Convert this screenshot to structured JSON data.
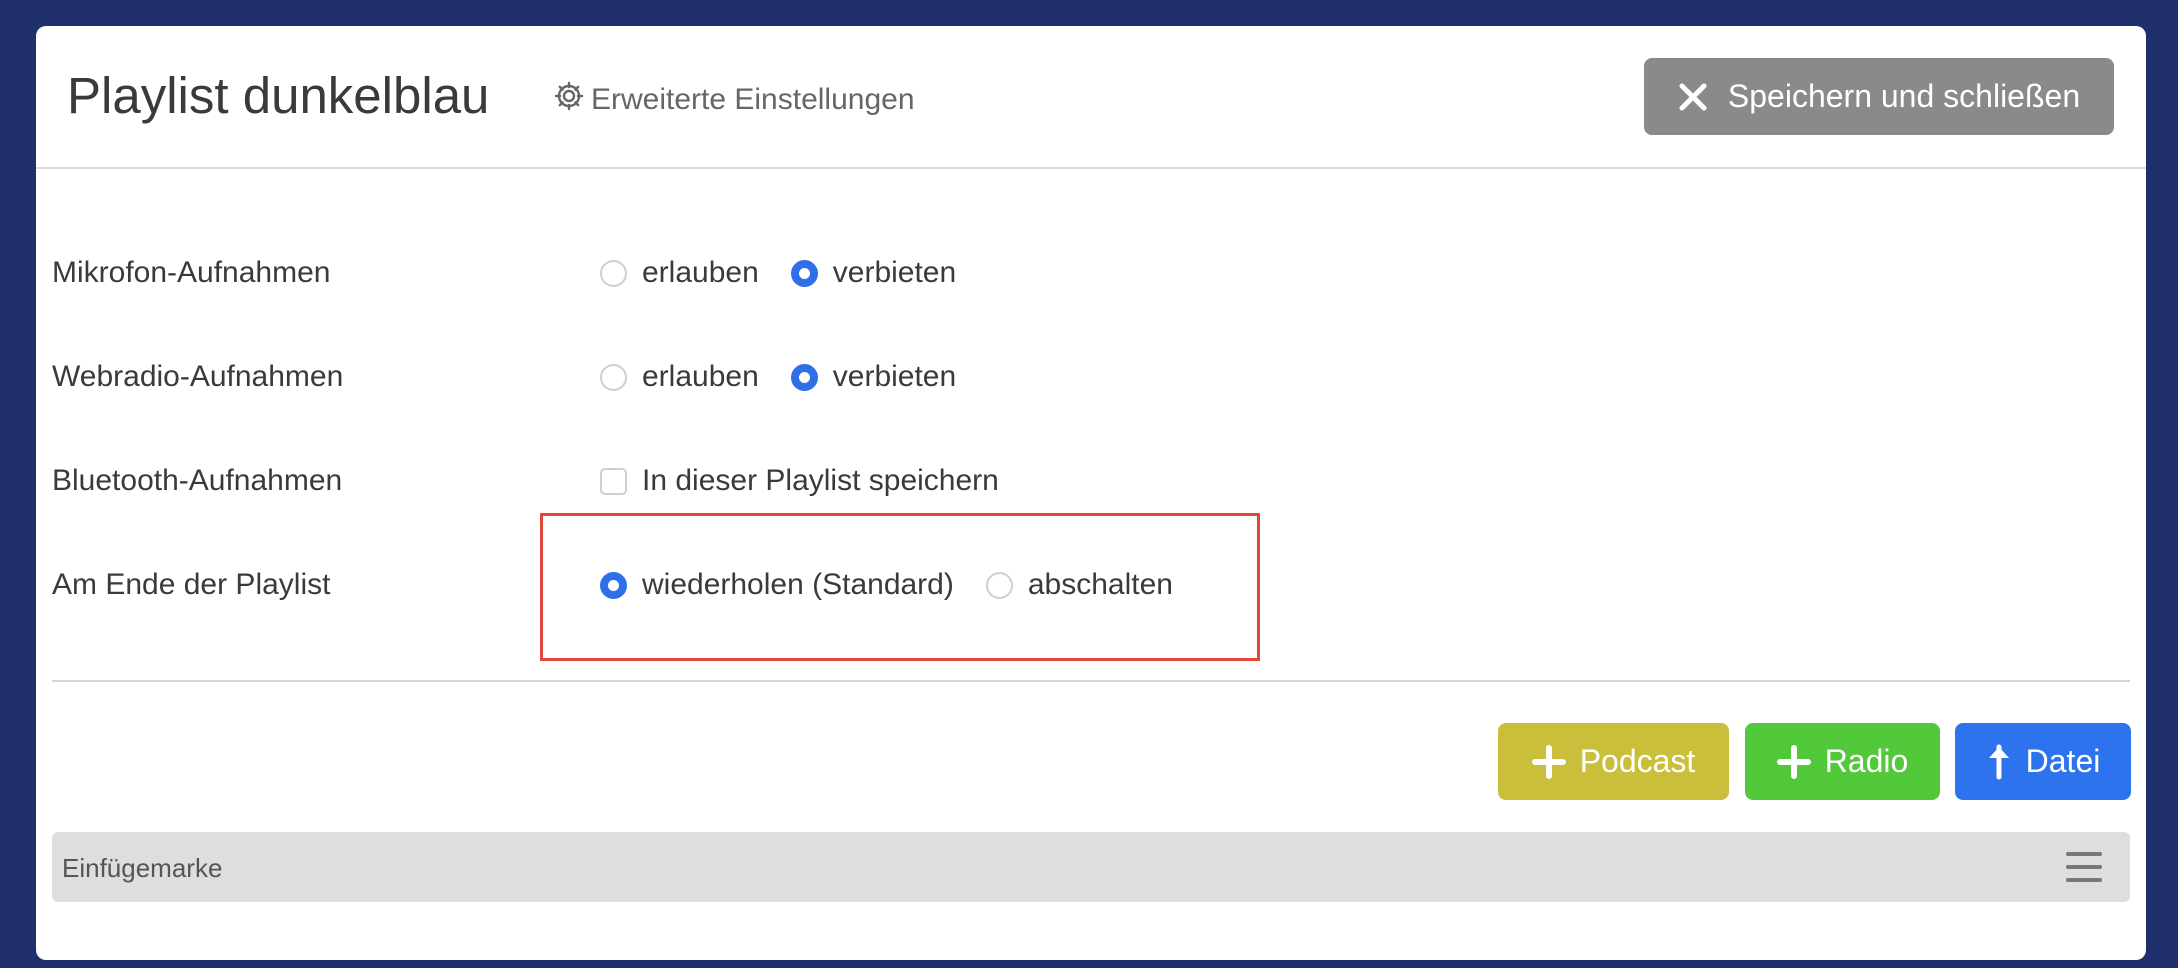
{
  "header": {
    "title": "Playlist dunkelblau",
    "advanced_settings": "Erweiterte Einstellungen",
    "close_button": "Speichern und schließen"
  },
  "settings": {
    "mic": {
      "label": "Mikrofon-Aufnahmen",
      "options": [
        "erlauben",
        "verbieten"
      ],
      "selected": "verbieten"
    },
    "webradio": {
      "label": "Webradio-Aufnahmen",
      "options": [
        "erlauben",
        "verbieten"
      ],
      "selected": "verbieten"
    },
    "bluetooth": {
      "label": "Bluetooth-Aufnahmen",
      "checkbox_label": "In dieser Playlist speichern",
      "checked": false
    },
    "end": {
      "label": "Am Ende der Playlist",
      "options": [
        "wiederholen (Standard)",
        "abschalten"
      ],
      "selected": "wiederholen (Standard)"
    }
  },
  "actions": {
    "podcast": "Podcast",
    "radio": "Radio",
    "file": "Datei"
  },
  "insert_marker": {
    "label": "Einfügemarke"
  },
  "colors": {
    "background": "#1f2f6b",
    "radio_selected": "#2f6fe8",
    "podcast": "#c9bf3a",
    "radio_button": "#52c83b",
    "file_button": "#2e73ee",
    "close_button": "#8a8a8a",
    "highlight": "#e0483c"
  }
}
